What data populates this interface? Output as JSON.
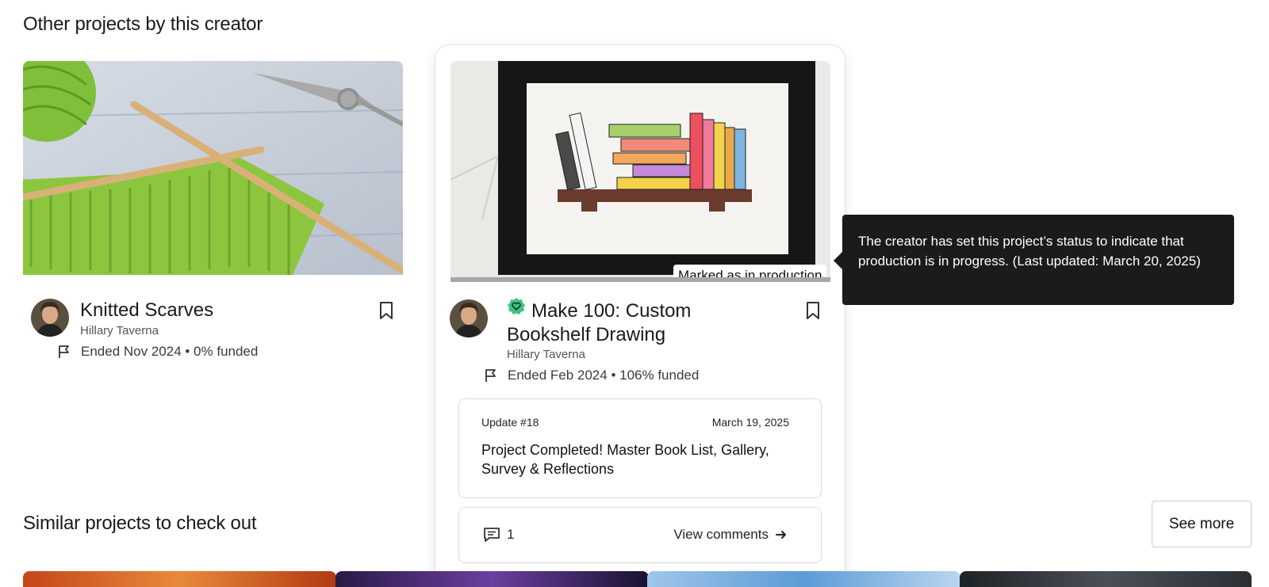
{
  "sections": {
    "other_title": "Other projects by this creator",
    "similar_title": "Similar projects to check out",
    "see_more_label": "See more"
  },
  "cards": [
    {
      "title": "Knitted Scarves",
      "creator": "Hillary Taverna",
      "meta": "Ended Nov 2024 • 0% funded",
      "image": "knitting-photo",
      "funded_percent": 0
    },
    {
      "title_line1": "Make 100: Custom",
      "title_line2": "Bookshelf Drawing",
      "creator": "Hillary Taverna",
      "meta": "Ended Feb 2024 • 106% funded",
      "image": "bookshelf-drawing-photo",
      "status_badge": "Marked as in production",
      "funded_percent": 106,
      "update": {
        "number": "Update #18",
        "date": "March 19, 2025",
        "title": "Project Completed! Master Book List, Gallery, Survey & Reflections"
      },
      "comments": {
        "count": "1",
        "link": "View comments"
      }
    }
  ],
  "tooltip": {
    "text": "The creator has set this project’s status to indicate that production is in progress. (Last updated: March 20, 2025)"
  },
  "colors": {
    "verified_green": "#3fc380",
    "tooltip_bg": "#1b1b1b",
    "knit_green": "#8cc63f"
  },
  "icons": [
    "bookmark-icon",
    "flag-icon",
    "verified-heart-icon",
    "comment-icon",
    "arrow-right-icon"
  ]
}
